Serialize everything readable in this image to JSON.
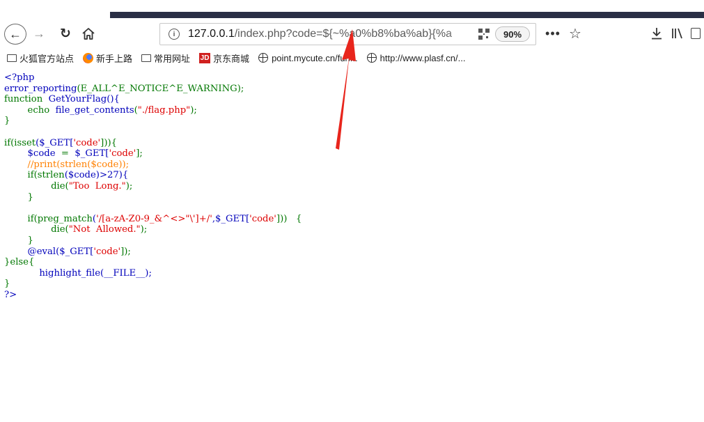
{
  "browser": {
    "url_host": "127.0.0.1",
    "url_rest": "/index.php?code=${~%a0%b8%ba%ab}{%a",
    "zoom": "90%",
    "icons": {
      "back": "back-arrow-icon",
      "forward": "forward-arrow-icon",
      "reload": "reload-icon",
      "home": "home-icon",
      "info": "info-icon",
      "qr": "qr-code-icon",
      "more": "more-icon",
      "star": "bookmark-star-icon",
      "download": "download-icon",
      "library": "library-icon",
      "sidebar": "sidebar-icon"
    }
  },
  "bookmarks": [
    {
      "label": "火狐官方站点",
      "icon": "folder-icon"
    },
    {
      "label": "新手上路",
      "icon": "firefox-icon"
    },
    {
      "label": "常用网址",
      "icon": "folder-icon"
    },
    {
      "label": "京东商城",
      "icon": "jd-icon",
      "icon_text": "JD"
    },
    {
      "label": "point.mycute.cn/fun...",
      "icon": "globe-icon"
    },
    {
      "label": "http://www.plasf.cn/...",
      "icon": "globe-icon"
    }
  ],
  "source": {
    "colors": {
      "default": "#0000bb",
      "keyword": "#007700",
      "string": "#dd0000",
      "comment": "#ff8000"
    },
    "open_tag": "<?php",
    "l2_fn": "error_reporting",
    "l2_rest": "(E_ALL^E_NOTICE^E_WARNING);",
    "l3_kw": "function",
    "l3_rest": "GetYourFlag(){",
    "l4_kw": "echo",
    "l4_fn": "file_get_contents",
    "l4_str": "\"./flag.php\"",
    "l4_end": ");",
    "close_brace": "}",
    "l6_a": "if(isset",
    "l6_b": "($_GET[",
    "l6_str": "'code'",
    "l6_c": "])){",
    "l7_a": "$code",
    "l7_b": "=",
    "l7_c": "$_GET[",
    "l7_str": "'code'",
    "l7_d": "];",
    "l8_cmt": "//print(strlen($code));",
    "l9_a": "if(strlen",
    "l9_b": "($code)>27){",
    "l10_a": "die(",
    "l10_str": "\"Too  Long.\"",
    "l10_end": ");",
    "l12_a": "if(preg_match",
    "l12_b": "(",
    "l12_str": "'/[a-zA-Z0-9_&^<>\"\\']+/'",
    "l12_c": ",$_GET[",
    "l12_str2": "'code'",
    "l12_d": "]))   {",
    "l13_a": "die(",
    "l13_str": "\"Not  Allowed.\"",
    "l13_end": ");",
    "l15_a": "@eval",
    "l15_b": "($_GET[",
    "l15_str": "'code'",
    "l15_c": "]);",
    "l16": "}else{",
    "l17_a": "highlight_file",
    "l17_b": "(__FILE__);",
    "close_tag": "?>"
  }
}
